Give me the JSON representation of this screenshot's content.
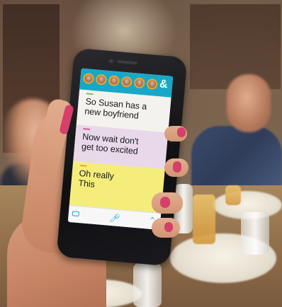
{
  "image": {
    "description_colors": {
      "app_header": "#18a8c7",
      "bubble_1_bg": "#f4f2ee",
      "bubble_2_bg": "#e8d8ea",
      "bubble_3_bg": "#f5ed7a",
      "nail_polish": "#d63f6a"
    }
  },
  "app": {
    "header": {
      "avatars": [
        {
          "icon": "avatar-icon"
        },
        {
          "icon": "avatar-icon"
        },
        {
          "icon": "avatar-icon"
        },
        {
          "icon": "avatar-icon"
        },
        {
          "icon": "avatar-icon"
        },
        {
          "icon": "avatar-icon"
        }
      ],
      "add_symbol": "&"
    },
    "messages": [
      {
        "speaker_color": "#7cc14d",
        "text": "So Susan has a\nnew boyfriend"
      },
      {
        "speaker_color": "#d65a94",
        "text": "Now wait don't\nget too excited"
      },
      {
        "speaker_color": "#e9a53a",
        "text": "Oh really\nThis"
      }
    ],
    "footer": {
      "left_icon": "keyboard-icon",
      "center_icon": "microphone-icon",
      "right_icon": "chevron-icon"
    }
  }
}
